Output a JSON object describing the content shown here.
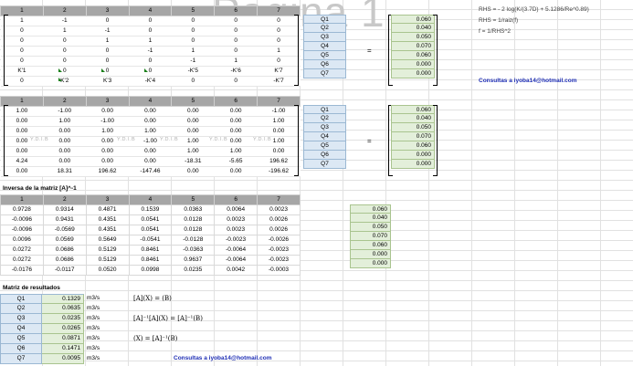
{
  "watermark": "Pagina 1",
  "headers": [
    "1",
    "2",
    "3",
    "4",
    "5",
    "6",
    "7"
  ],
  "matrix_a": [
    [
      "1",
      "-1",
      "0",
      "0",
      "0",
      "0",
      "0"
    ],
    [
      "0",
      "1",
      "-1",
      "0",
      "0",
      "0",
      "0"
    ],
    [
      "0",
      "0",
      "1",
      "1",
      "0",
      "0",
      "0"
    ],
    [
      "0",
      "0",
      "0",
      "-1",
      "1",
      "0",
      "1"
    ],
    [
      "0",
      "0",
      "0",
      "0",
      "-1",
      "1",
      "0"
    ],
    [
      "K'1",
      "0",
      "0",
      "0",
      "-K'5",
      "-K'6",
      "K'7"
    ],
    [
      "0",
      "K'2",
      "K'3",
      "-K'4",
      "0",
      "0",
      "-K'7"
    ]
  ],
  "matrix_b": [
    [
      "1.00",
      "-1.00",
      "0.00",
      "0.00",
      "0.00",
      "0.00",
      "-1.00"
    ],
    [
      "0.00",
      "1.00",
      "-1.00",
      "0.00",
      "0.00",
      "0.00",
      "1.00"
    ],
    [
      "0.00",
      "0.00",
      "1.00",
      "1.00",
      "0.00",
      "0.00",
      "0.00"
    ],
    [
      "0.00",
      "0.00",
      "0.00",
      "-1.00",
      "1.00",
      "0.00",
      "1.00"
    ],
    [
      "0.00",
      "0.00",
      "0.00",
      "0.00",
      "1.00",
      "1.00",
      "0.00"
    ],
    [
      "4.24",
      "0.00",
      "0.00",
      "0.00",
      "-18.31",
      "-5.65",
      "196.62"
    ],
    [
      "0.00",
      "18.31",
      "196.62",
      "-147.46",
      "0.00",
      "0.00",
      "-196.62"
    ]
  ],
  "ydib": "Y.D.I.B",
  "q_labels": [
    "Q1",
    "Q2",
    "Q3",
    "Q4",
    "Q5",
    "Q6",
    "Q7"
  ],
  "rhs_values": [
    "0.060",
    "0.040",
    "0.050",
    "0.070",
    "0.060",
    "0.000",
    "0.000"
  ],
  "eq_sign": "=",
  "notes": {
    "line1": "RHS = - 2 log(K/(3.7D) + 5.1286/Re^0.89)",
    "line2": "RHS = 1/raiz(f)",
    "line3": "f = 1/RHS^2"
  },
  "contact_link": "Consultas a iyoba14@hotmail.com",
  "inverse_title": "Inversa de la matriz  [A]^-1",
  "matrix_inv": [
    [
      "0.9728",
      "0.9314",
      "0.4871",
      "0.1539",
      "0.0363",
      "0.0064",
      "0.0023"
    ],
    [
      "-0.0096",
      "0.9431",
      "0.4351",
      "0.0541",
      "0.0128",
      "0.0023",
      "0.0026"
    ],
    [
      "-0.0096",
      "-0.0569",
      "0.4351",
      "0.0541",
      "0.0128",
      "0.0023",
      "0.0026"
    ],
    [
      "0.0096",
      "0.0569",
      "0.5649",
      "-0.0541",
      "-0.0128",
      "-0.0023",
      "-0.0026"
    ],
    [
      "0.0272",
      "0.0686",
      "0.5129",
      "0.8461",
      "-0.0363",
      "-0.0064",
      "-0.0023"
    ],
    [
      "0.0272",
      "0.0686",
      "0.5129",
      "0.8461",
      "0.9637",
      "-0.0064",
      "-0.0023"
    ],
    [
      "-0.0176",
      "-0.0117",
      "0.0520",
      "0.0998",
      "0.0235",
      "0.0042",
      "-0.0003"
    ]
  ],
  "results_title": "Matriz de resultados",
  "results": [
    {
      "q": "Q1",
      "v": "0.1329",
      "u": "m3/s"
    },
    {
      "q": "Q2",
      "v": "0.0635",
      "u": "m3/s"
    },
    {
      "q": "Q3",
      "v": "0.0235",
      "u": "m3/s"
    },
    {
      "q": "Q4",
      "v": "0.0265",
      "u": "m3/s"
    },
    {
      "q": "Q5",
      "v": "0.0871",
      "u": "m3/s"
    },
    {
      "q": "Q6",
      "v": "0.1471",
      "u": "m3/s"
    },
    {
      "q": "Q7",
      "v": "0.0095",
      "u": "m3/s"
    }
  ],
  "formulas": {
    "f1": "[A](X) = (B)",
    "f2": "[A]⁻¹[A](X) = [A]⁻¹(B)",
    "f3": "(X) = [A]⁻¹(B)"
  }
}
